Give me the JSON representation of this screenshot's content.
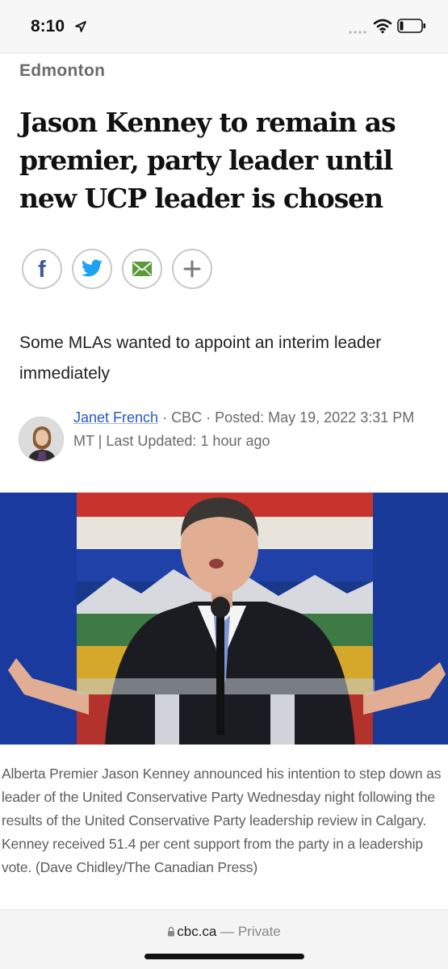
{
  "status_bar": {
    "time": "8:10",
    "icons": [
      "location-arrow-icon",
      "cellular-signal-icon",
      "wifi-icon",
      "battery-icon"
    ]
  },
  "article": {
    "section": "Edmonton",
    "headline": "Jason Kenney to remain as premier, party leader until new UCP leader is chosen",
    "deck": "Some MLAs wanted to appoint an interim leader immediately",
    "byline": {
      "author": "Janet French",
      "sep1": " · ",
      "source": "CBC",
      "sep2": " · ",
      "posted": "Posted: May 19, 2022 3:31 PM MT | Last Updated: 1 hour ago"
    },
    "caption": "Alberta Premier Jason Kenney announced his intention to step down as leader of the United Conservative Party Wednesday night following the results of the United Conservative Party leadership review in Calgary. Kenney received 51.4 per cent support from the party in a leadership vote. (Dave Chidley/The Canadian Press)"
  },
  "share": {
    "buttons": [
      {
        "name": "facebook",
        "icon": "facebook-icon",
        "color": "#3b5998"
      },
      {
        "name": "twitter",
        "icon": "twitter-icon",
        "color": "#1da1f2"
      },
      {
        "name": "email",
        "icon": "envelope-icon",
        "color": "#5a9a3a"
      },
      {
        "name": "more",
        "icon": "plus-icon",
        "color": "#777777"
      }
    ]
  },
  "browser": {
    "domain": "cbc.ca",
    "suffix": " — Private"
  },
  "colors": {
    "link": "#2b57c1",
    "section": "#6b6b6b",
    "caption": "#5d5d5d"
  }
}
